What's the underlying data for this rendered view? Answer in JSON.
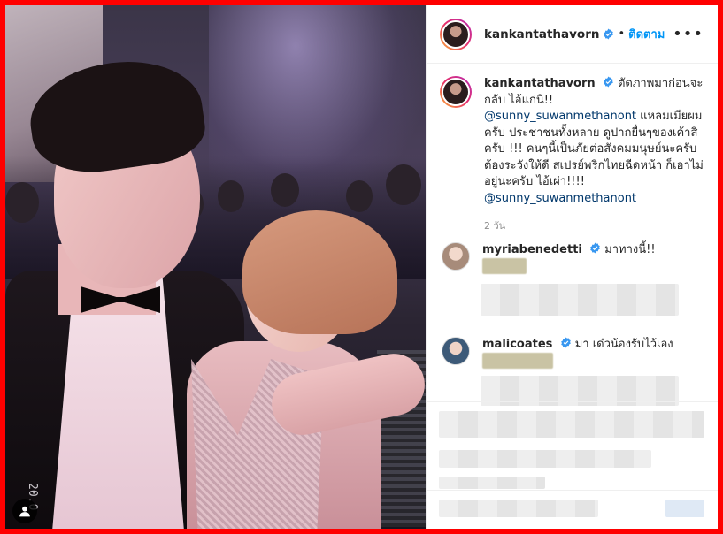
{
  "post": {
    "username": "kankantathavorn",
    "separator": "•",
    "follow_label": "ติดตาม",
    "more_label": "•••"
  },
  "caption": {
    "username": "kankantathavorn",
    "text_1": "ตัดภาพมาก่อนจะกลับ ไอ้แก่นี่!!",
    "mention_1": "@sunny_suwanmethanont",
    "text_2": "แหลมเมียผมครับ ประชาชนทั้งหลาย ดูปากยื่นๆของเค้าสิครับ !!! คนๆนี้เป็นภัยต่อสังคมมนุษย์นะครับ ต้องระวังให้ดี สเปรย์พริกไทยฉีดหน้า ก็เอาไม่อยู่นะครับ ไอ้เผ่า!!!!",
    "mention_2": "@sunny_suwanmethanont",
    "time_ago": "2 วัน"
  },
  "comments": [
    {
      "username": "myriabenedetti",
      "text": "มาทางนี้!!"
    },
    {
      "username": "malicoates",
      "text": "มา เด๋วน้องรับไว้เอง"
    }
  ],
  "photo": {
    "timestamp": "20.0"
  },
  "colors": {
    "frame": "#ff0000",
    "link": "#0095f6",
    "mention": "#00376b",
    "verified": "#3897f0"
  }
}
